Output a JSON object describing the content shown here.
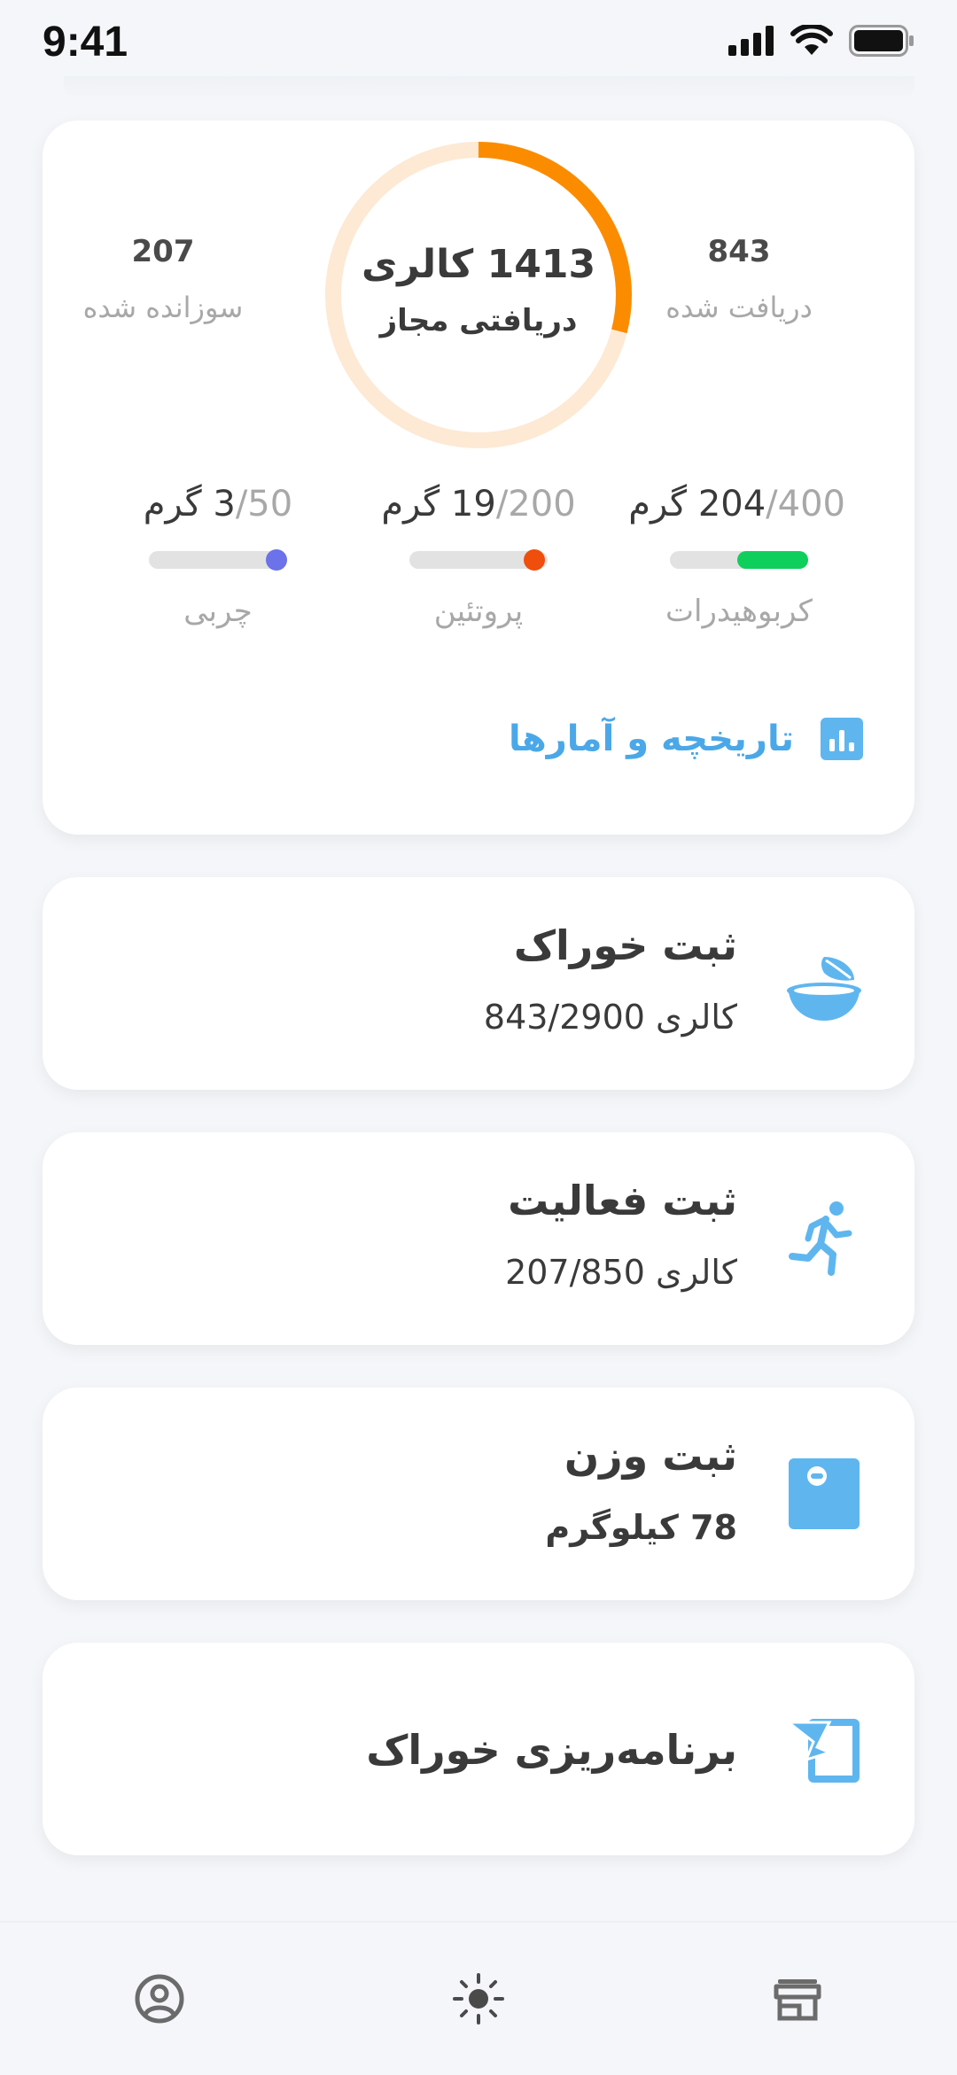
{
  "status_bar": {
    "time": "9:41"
  },
  "summary": {
    "ring": {
      "value": "1413 کالری",
      "label": "دریافتی مجاز",
      "progress": 0.29,
      "track_color": "#fde9d4",
      "progress_color": "#fb8c00"
    },
    "burned": {
      "value": "207",
      "label": "سوزانده شده"
    },
    "received": {
      "value": "843",
      "label": "دریافت شده"
    },
    "macros": [
      {
        "name": "کربوهیدرات",
        "current": "204",
        "total": "/400",
        "unit": " گرم",
        "progress": 0.51,
        "color": "#0fcf5c"
      },
      {
        "name": "پروتئین",
        "current": "19",
        "total": "/200",
        "unit": " گرم",
        "progress": 0.095,
        "color": "#ef4e0c"
      },
      {
        "name": "چربی",
        "current": "3",
        "total": "/50",
        "unit": " گرم",
        "progress": 0.06,
        "color": "#6b72ea"
      }
    ],
    "history_link": "تاریخچه و آمارها"
  },
  "actions": [
    {
      "title": "ثبت خوراک",
      "subtitle_unit": "کالری",
      "subtitle_value": "843/2900",
      "icon": "food-bowl-icon"
    },
    {
      "title": "ثبت فعالیت",
      "subtitle_unit": "کالری",
      "subtitle_value": "207/850",
      "icon": "running-icon"
    },
    {
      "title": "ثبت وزن",
      "subtitle_value": "78 کیلوگرم",
      "icon": "scale-icon"
    },
    {
      "title": "برنامه‌ریزی خوراک",
      "icon": "meal-plan-icon"
    }
  ],
  "nav": [
    {
      "icon": "profile-icon"
    },
    {
      "icon": "sun-icon"
    },
    {
      "icon": "shop-icon"
    }
  ],
  "colors": {
    "accent": "#4aa8e8",
    "icon_blue": "#5fb6ef"
  }
}
